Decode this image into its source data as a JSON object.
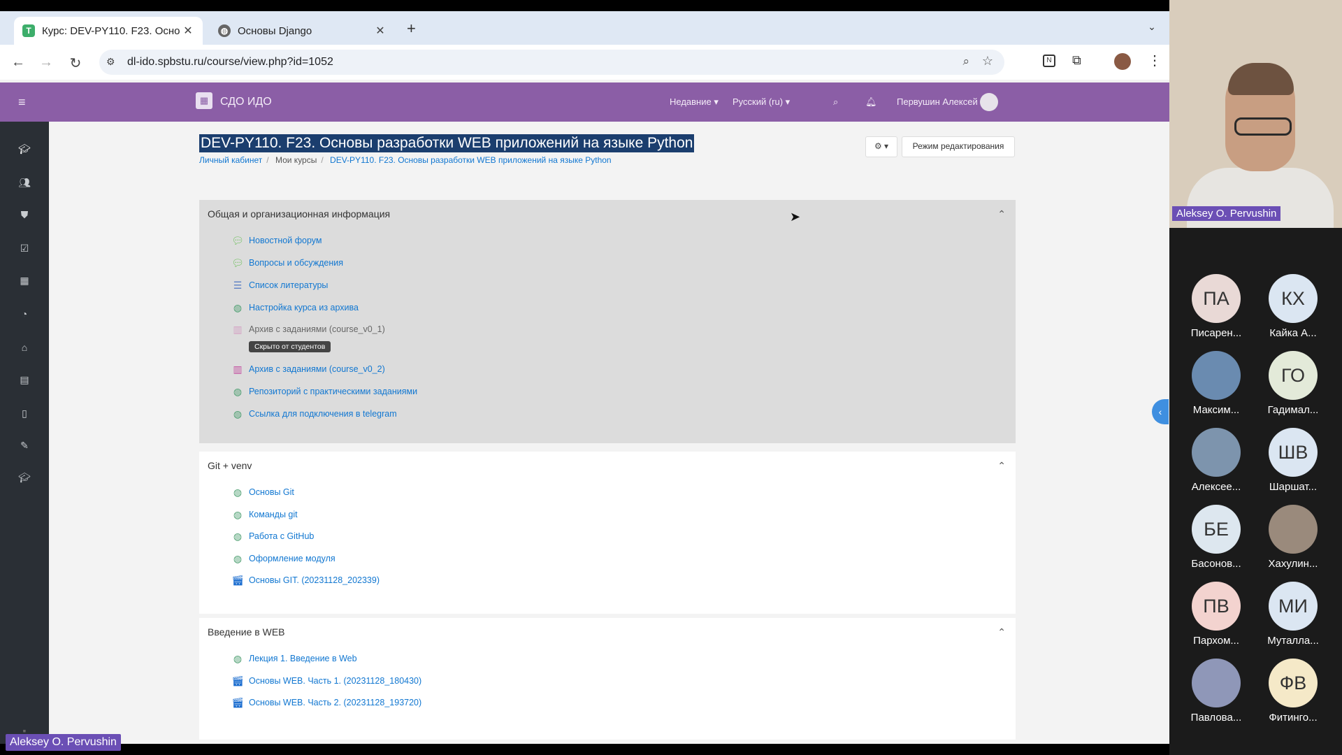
{
  "browser": {
    "tabs": [
      {
        "title": "Курс: DEV-PY110. F23. Осно"
      },
      {
        "title": "Основы Django"
      }
    ],
    "new_tab": "+",
    "url": "dl-ido.spbstu.ru/course/view.php?id=1052"
  },
  "moodle": {
    "site_name": "СДО ИДО",
    "menu_recent": "Недавние ▾",
    "menu_lang": "Русский (ru) ▾",
    "user_name": "Первушин Алексей",
    "course_title": "DEV-PY110. F23. Основы разработки WEB приложений на языке Python",
    "breadcrumb": [
      "Личный кабинет",
      "Мои курсы",
      "DEV-PY110. F23. Основы разработки WEB приложений на языке Python"
    ],
    "edit_mode_label": "Режим редактирования",
    "sections": [
      {
        "title": "Общая и организационная информация",
        "activities": [
          {
            "label": "Новостной форум",
            "icon": "forum-icon"
          },
          {
            "label": "Вопросы и обсуждения",
            "icon": "forum-icon"
          },
          {
            "label": "Список литературы",
            "icon": "book-icon"
          },
          {
            "label": "Настройка курса из архива",
            "icon": "url-icon"
          },
          {
            "label": "Архив с заданиями (course_v0_1)",
            "icon": "archive-icon",
            "hidden": true,
            "badge": "Скрыто от студентов"
          },
          {
            "label": "Архив с заданиями (course_v0_2)",
            "icon": "archive-icon"
          },
          {
            "label": "Репозиторий с практическими заданиями",
            "icon": "url-icon"
          },
          {
            "label": "Ссылка для подключения в telegram",
            "icon": "url-icon"
          }
        ]
      },
      {
        "title": "Git + venv",
        "activities": [
          {
            "label": "Основы Git",
            "icon": "url-icon"
          },
          {
            "label": "Команды git",
            "icon": "url-icon"
          },
          {
            "label": "Работа с GitHub",
            "icon": "url-icon"
          },
          {
            "label": "Оформление модуля",
            "icon": "url-icon"
          },
          {
            "label": "Основы GIT. (20231128_202339)",
            "icon": "video-icon"
          }
        ]
      },
      {
        "title": "Введение в WEB",
        "activities": [
          {
            "label": "Лекция 1. Введение в Web",
            "icon": "url-icon"
          },
          {
            "label": "Основы WEB. Часть 1. (20231128_180430)",
            "icon": "video-icon"
          },
          {
            "label": "Основы WEB. Часть 2. (20231128_193720)",
            "icon": "video-icon"
          }
        ]
      }
    ]
  },
  "meeting": {
    "speaker_name": "Aleksey O. Pervushin",
    "bottom_name": "Aleksey O. Pervushin",
    "participants": [
      {
        "initials": "ПА",
        "name": "Писарен...",
        "color": "#e9d9d6",
        "photo": false
      },
      {
        "initials": "КХ",
        "name": "Кайка А...",
        "color": "#dbe6f2",
        "photo": false
      },
      {
        "initials": "",
        "name": "Максим...",
        "color": "#6a8bb0",
        "photo": true
      },
      {
        "initials": "ГО",
        "name": "Гадимал...",
        "color": "#e3ead9",
        "photo": false
      },
      {
        "initials": "",
        "name": "Алексее...",
        "color": "#7d94ad",
        "photo": true
      },
      {
        "initials": "ШВ",
        "name": "Шаршат...",
        "color": "#dbe6f2",
        "photo": false
      },
      {
        "initials": "БЕ",
        "name": "Басонов...",
        "color": "#dde7ef",
        "photo": false
      },
      {
        "initials": "",
        "name": "Хахулин...",
        "color": "#9a8a7c",
        "photo": true
      },
      {
        "initials": "ПВ",
        "name": "Пархом...",
        "color": "#f3d3cf",
        "photo": false
      },
      {
        "initials": "МИ",
        "name": "Муталла...",
        "color": "#dbe6f2",
        "photo": false
      },
      {
        "initials": "",
        "name": "Павлова...",
        "color": "#8f97b8",
        "photo": true
      },
      {
        "initials": "ФВ",
        "name": "Фитинго...",
        "color": "#f5e9c8",
        "photo": false
      }
    ]
  }
}
